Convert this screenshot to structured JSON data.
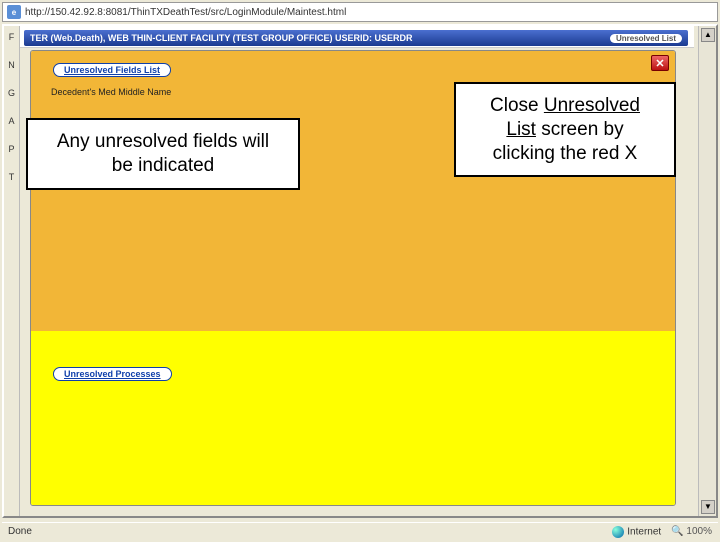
{
  "url_bar": {
    "icon_letter": "e",
    "url": "http://150.42.92.8:8081/ThinTXDeathTest/src/LoginModule/Maintest.html"
  },
  "window": {
    "title": "TER (Web.Death), WEB THIN-CLIENT FACILITY (TEST GROUP OFFICE) USERID: USERDR",
    "right_pill": "Unresolved List"
  },
  "left_strip": {
    "a": "F",
    "b": "N",
    "c": "G",
    "d": "A",
    "e": "P",
    "f": "T"
  },
  "dialog": {
    "top_button": "Unresolved Fields List",
    "sub_text": "Decedent's Med Middle Name",
    "close_label": "✕",
    "bottom_button": "Unresolved Processes"
  },
  "callouts": {
    "left_line1": "Any unresolved fields will",
    "left_line2": "be indicated",
    "right_pre": "Close ",
    "right_under1": "Unresolved",
    "right_under2": "List",
    "right_post1": " screen by",
    "right_post2": "clicking the red X"
  },
  "status": {
    "left": "Done",
    "net_label": "Internet",
    "zoom": "100%"
  }
}
